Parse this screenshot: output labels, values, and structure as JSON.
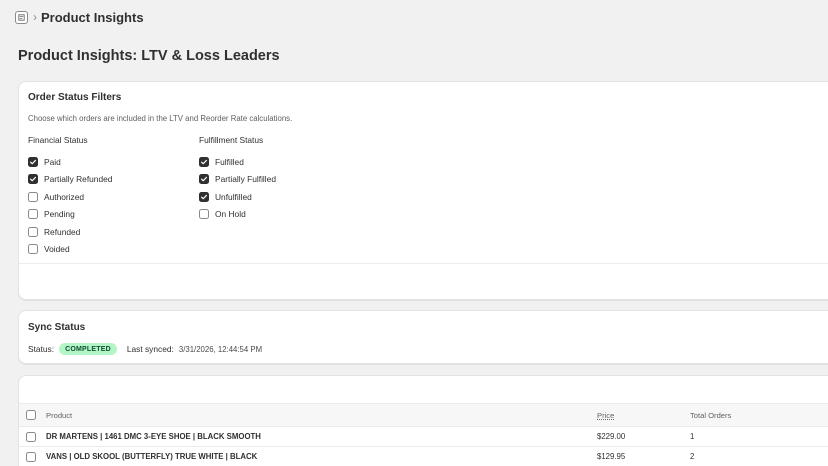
{
  "topbar": {
    "app_icon": "app-icon",
    "separator": "›",
    "title": "Product Insights"
  },
  "page": {
    "title": "Product Insights: LTV & Loss Leaders"
  },
  "filters": {
    "title": "Order Status Filters",
    "description": "Choose which orders are included in the LTV and Reorder Rate calculations.",
    "financial": {
      "title": "Financial Status",
      "options": [
        {
          "label": "Paid",
          "checked": true
        },
        {
          "label": "Partially Refunded",
          "checked": true
        },
        {
          "label": "Authorized",
          "checked": false
        },
        {
          "label": "Pending",
          "checked": false
        },
        {
          "label": "Refunded",
          "checked": false
        },
        {
          "label": "Voided",
          "checked": false
        }
      ]
    },
    "fulfillment": {
      "title": "Fulfillment Status",
      "options": [
        {
          "label": "Fulfilled",
          "checked": true
        },
        {
          "label": "Partially Fulfilled",
          "checked": true
        },
        {
          "label": "Unfulfilled",
          "checked": true
        },
        {
          "label": "On Hold",
          "checked": false
        }
      ]
    }
  },
  "sync": {
    "title": "Sync Status",
    "status_label": "Status:",
    "status_value": "COMPLETED",
    "status_color": "#b4f5c8",
    "last_synced_label": "Last synced:",
    "last_synced_value": "3/31/2026, 12:44:54 PM"
  },
  "table": {
    "columns": {
      "product": "Product",
      "price": "Price",
      "total_orders": "Total Orders"
    },
    "rows": [
      {
        "product": "DR MARTENS | 1461 DMC 3-EYE SHOE | BLACK SMOOTH",
        "price": "$229.00",
        "total_orders": "1"
      },
      {
        "product": "VANS | OLD SKOOL (BUTTERFLY) TRUE WHITE | BLACK",
        "price": "$129.95",
        "total_orders": "2"
      }
    ]
  }
}
